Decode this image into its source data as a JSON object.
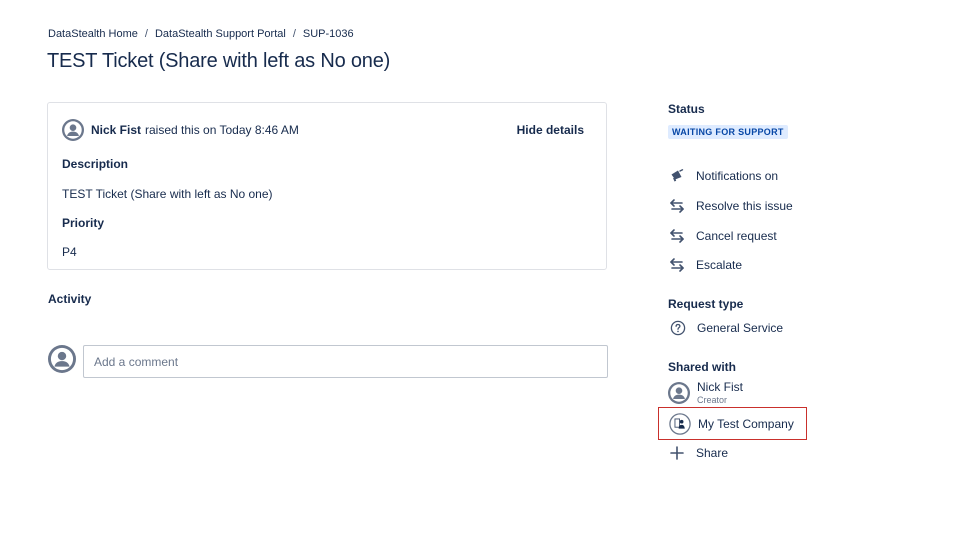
{
  "breadcrumb": {
    "items": [
      "DataStealth Home",
      "DataStealth Support Portal",
      "SUP-1036"
    ],
    "separator": "/"
  },
  "page_title": "TEST Ticket (Share with left as No one)",
  "request": {
    "reporter": "Nick Fist",
    "raised_text": "raised this on Today 8:46 AM",
    "hide_details_label": "Hide details",
    "description_label": "Description",
    "description_value": "TEST Ticket (Share with left as No one)",
    "priority_label": "Priority",
    "priority_value": "P4"
  },
  "activity": {
    "title": "Activity",
    "comment_placeholder": "Add a comment"
  },
  "sidebar": {
    "status_label": "Status",
    "status_value": "WAITING FOR SUPPORT",
    "actions": [
      {
        "label": "Notifications on",
        "icon": "megaphone-icon"
      },
      {
        "label": "Resolve this issue",
        "icon": "transition-icon"
      },
      {
        "label": "Cancel request",
        "icon": "transition-icon"
      },
      {
        "label": "Escalate",
        "icon": "transition-icon"
      }
    ],
    "request_type_label": "Request type",
    "request_type_value": "General Service",
    "shared_with_label": "Shared with",
    "shared_person_name": "Nick Fist",
    "shared_person_role": "Creator",
    "shared_org_name": "My Test Company",
    "share_label": "Share"
  },
  "colors": {
    "text": "#172B4D",
    "lozenge_bg": "#DEEBFF",
    "lozenge_text": "#0747A6",
    "highlight_border": "#C9302C",
    "border": "#DFE1E6"
  }
}
